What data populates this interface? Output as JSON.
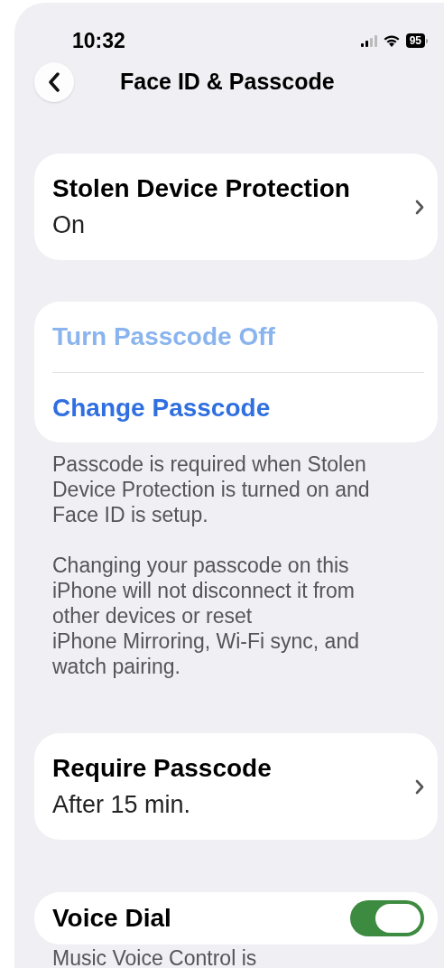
{
  "status_bar": {
    "time": "10:32",
    "battery": "95"
  },
  "nav": {
    "title": "Face ID & Passcode"
  },
  "sections": [
    {
      "kind": "detail",
      "rows": [
        {
          "label": "Stolen Device Protection",
          "value": "On"
        }
      ]
    },
    {
      "kind": "actions",
      "rows": [
        {
          "label": "Turn Passcode Off",
          "disabled": true
        },
        {
          "label": "Change Passcode",
          "disabled": false
        }
      ],
      "footer": [
        "Passcode is required when Stolen\nDevice Protection is turned on and\nFace ID is setup.",
        "Changing your passcode on this\niPhone will not disconnect it from\nother devices or reset\niPhone Mirroring, Wi-Fi sync, and\nwatch pairing."
      ]
    },
    {
      "kind": "detail",
      "rows": [
        {
          "label": "Require Passcode",
          "value": "After 15 min."
        }
      ]
    },
    {
      "kind": "toggle",
      "rows": [
        {
          "label": "Voice Dial",
          "on": true
        }
      ],
      "footer": [
        "Music Voice Control is"
      ]
    }
  ]
}
